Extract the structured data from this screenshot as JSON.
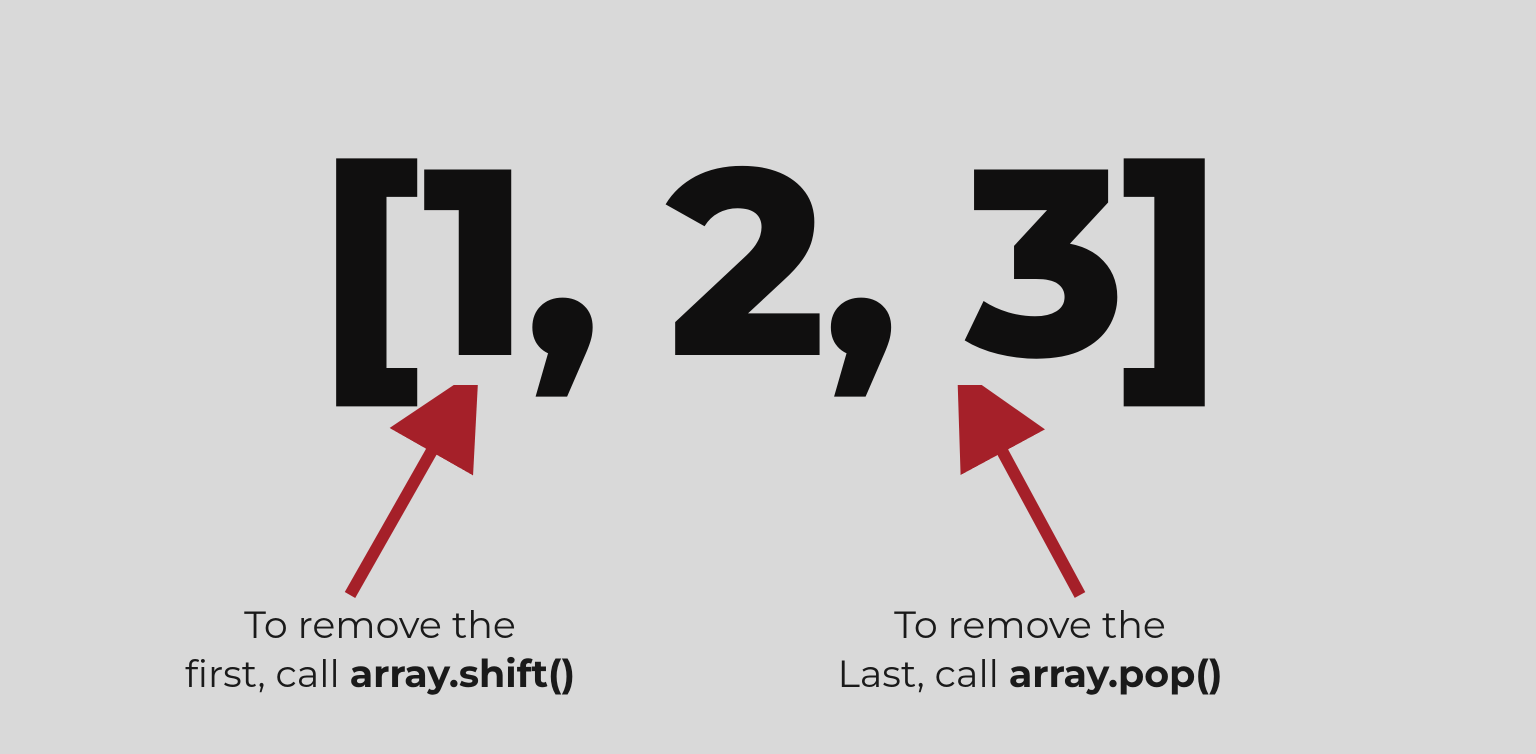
{
  "array_display": "[1, 2, 3]",
  "left_annotation": {
    "line1": "To remove the",
    "line2_prefix": "first, call ",
    "line2_bold": "array.shift()"
  },
  "right_annotation": {
    "line1": "To remove the",
    "line2_prefix": "Last, call ",
    "line2_bold": "array.pop()"
  },
  "arrow_color": "#a52029"
}
